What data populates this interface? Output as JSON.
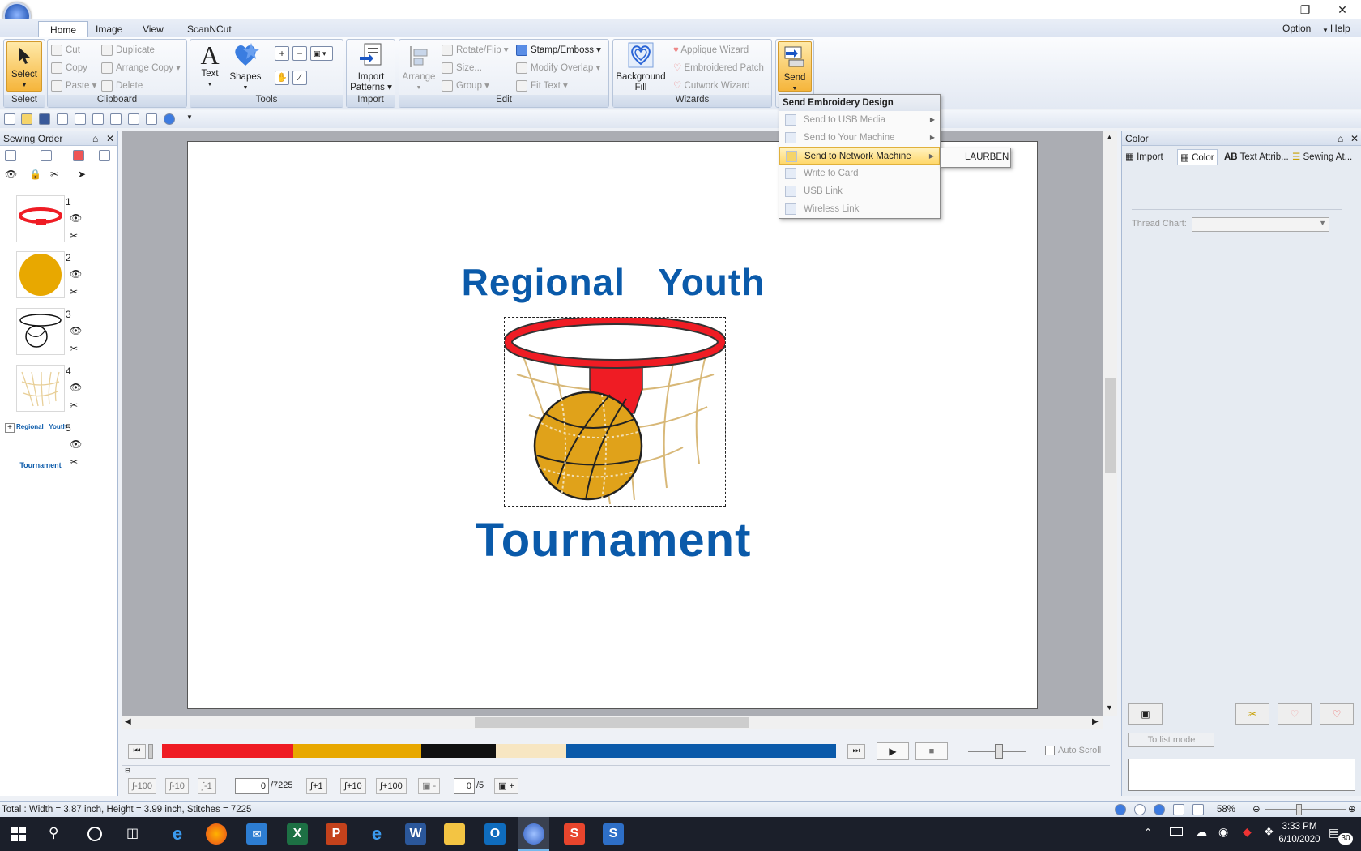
{
  "ribbon_tabs": [
    "Home",
    "Image",
    "View",
    "ScanNCut"
  ],
  "menu_right": {
    "option": "Option",
    "help": "Help"
  },
  "groups": {
    "select": {
      "title": "Select",
      "btn": "Select"
    },
    "clipboard": {
      "title": "Clipboard",
      "cut": "Cut",
      "copy": "Copy",
      "paste": "Paste",
      "duplicate": "Duplicate",
      "arrange_copy": "Arrange Copy",
      "delete": "Delete"
    },
    "tools": {
      "title": "Tools",
      "text": "Text",
      "shapes": "Shapes"
    },
    "import": {
      "title": "Import",
      "btn1": "Import",
      "btn2": "Patterns"
    },
    "edit": {
      "title": "Edit",
      "arrange": "Arrange",
      "rotate": "Rotate/Flip",
      "size": "Size...",
      "group": "Group",
      "stamp": "Stamp/Emboss",
      "modify": "Modify Overlap",
      "fit": "Fit Text"
    },
    "wizards": {
      "title": "Wizards",
      "bg1": "Background",
      "bg2": "Fill",
      "applique": "Applique Wizard",
      "patch": "Embroidered Patch",
      "cutwork": "Cutwork Wizard"
    },
    "send": {
      "btn": "Send"
    }
  },
  "dropdown": {
    "header": "Send Embroidery Design",
    "items": [
      "Send to USB Media",
      "Send to Your Machine",
      "Send to Network Machine",
      "Write to Card",
      "USB Link",
      "Wireless Link"
    ],
    "submenu_item": "LAURBEN"
  },
  "left_panel": {
    "title": "Sewing Order",
    "items": [
      "1",
      "2",
      "3",
      "4",
      "5"
    ],
    "thumb5_line1": "Regional   Youth",
    "thumb5_line2": "Tournament"
  },
  "canvas": {
    "line1": "Regional   Youth",
    "line2": "Tournament"
  },
  "right_panel": {
    "title": "Color",
    "tabs": [
      "Import",
      "Color",
      "Text Attrib...",
      "Sewing At..."
    ],
    "thread_chart": "Thread Chart:",
    "list_mode": "To list mode"
  },
  "sim": {
    "auto_scroll": "Auto Scroll",
    "stitch_value": "0",
    "stitch_total": "/7225",
    "color_value": "0",
    "color_total": "/5",
    "steps": [
      "-100",
      "-10",
      "-1",
      "+1",
      "+10",
      "+100"
    ]
  },
  "colors_bar": [
    {
      "color": "#ef1c24",
      "fraction": 0.195
    },
    {
      "color": "#e8a800",
      "fraction": 0.19
    },
    {
      "color": "#111111",
      "fraction": 0.11
    },
    {
      "color": "#f7e6c2",
      "fraction": 0.105
    },
    {
      "color": "#0a5aaa",
      "fraction": 0.4
    }
  ],
  "status": {
    "text": "Total : Width = 3.87 inch, Height = 3.99 inch, Stitches = 7225",
    "zoom": "58%"
  },
  "taskbar": {
    "time": "3:33 PM",
    "date": "6/10/2020",
    "notif": "30"
  }
}
